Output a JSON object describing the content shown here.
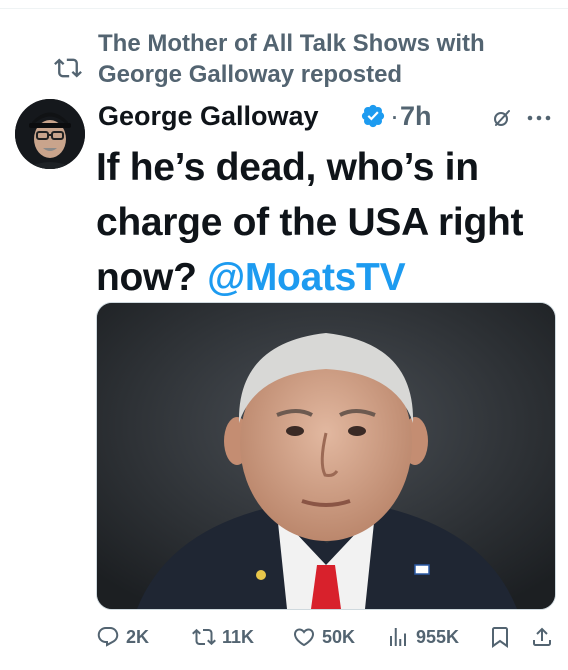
{
  "repost": {
    "text": "The Mother of All Talk Shows with George Galloway reposted",
    "icon": "repost-icon"
  },
  "author": {
    "name": "George Galloway",
    "separator": "·",
    "time": "7h",
    "verified_icon": "verified-badge-icon",
    "verified_color": "#1d9bf0"
  },
  "tweet": {
    "text_part1": "If he’s dead, who’s in charge of the USA right now? ",
    "mention": "@MoatsTV",
    "mention_color": "#1d9bf0"
  },
  "media": {
    "description_icon": "photo-of-man-in-suit"
  },
  "actions": {
    "replies": "2K",
    "reposts": "11K",
    "likes": "50K",
    "views": "955K"
  },
  "colors": {
    "text_primary": "#0f1419",
    "text_secondary": "#536471",
    "accent": "#1d9bf0"
  }
}
